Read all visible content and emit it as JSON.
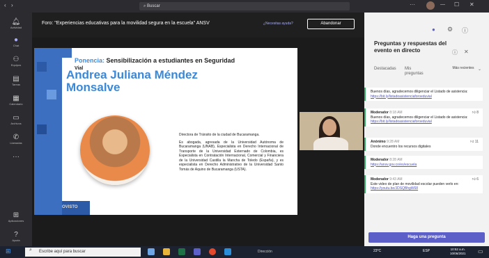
{
  "titlebar": {
    "search_placeholder": "Buscar"
  },
  "rail": [
    {
      "label": "Actividad",
      "icon": "bell-icon"
    },
    {
      "label": "Chat",
      "icon": "chat-icon"
    },
    {
      "label": "Equipos",
      "icon": "teams-icon"
    },
    {
      "label": "Tareas",
      "icon": "assignments-icon"
    },
    {
      "label": "Calendario",
      "icon": "calendar-icon"
    },
    {
      "label": "Archivos",
      "icon": "files-icon"
    },
    {
      "label": "Llamadas",
      "icon": "phone-icon"
    },
    {
      "label": "Aplicaciones",
      "icon": "apps-icon"
    },
    {
      "label": "Ayuda",
      "icon": "help-icon"
    }
  ],
  "meeting": {
    "title": "Foro: \"Experiencias educativas para la movilidad segura en la escuela\" ANSV",
    "help_link": "¿Necesitas ayuda?",
    "leave_button": "Abandonar"
  },
  "slide": {
    "ponencia_label": "Ponencia:",
    "ponencia_title": "Sensibilización a estudiantes en Seguridad",
    "ponencia_title_2": "Vial",
    "speaker_name": "Andrea Juliana Méndez Monsalve",
    "bio_role": "Directora de Tránsito de la ciudad de Bucaramanga.",
    "bio_text": "Es abogada, agresada de la Universidad Autónoma de Bucaramanga (UNAB), Especialista en Derecho Internacional de Transporte de la Universidad Externado de Colombia, es Especialista en Contratación Internacional, Comercial y Financiera de la Universidad Castilla la Mancha de Toledo (España), y es especialista en Derecho Administrativo de la Universidad Santo Tomás de Aquino de Bucaramanga (USTA).",
    "logo_text": "OVISTO"
  },
  "qna": {
    "title": "Preguntas y respuestas del evento en directo",
    "tabs": [
      "Destacadas",
      "Mis preguntas"
    ],
    "sort": "Más recientes",
    "messages": [
      {
        "author": "",
        "time": "",
        "text": "Buenos días, agradecemos diligenciar el Listado de asistencia:",
        "link": "https://bit.ly/listadoasistenciaforoeduvial",
        "likes": ""
      },
      {
        "author": "Moderador",
        "time": "8:18 AM",
        "text": "Buenos días, agradecemos diligenciar el Listado de asistencia:",
        "link": "https://bit.ly/listadoasistenciaforoeduvial",
        "likes": "8"
      },
      {
        "author": "Anónimo",
        "time": "9:28 AM",
        "text": "Donde encuentro los recursos digitales",
        "link": "",
        "likes": "11"
      },
      {
        "author": "Moderador",
        "time": "8:28 AM",
        "text": "",
        "link": "https://ansv.gov.co/es/escuela",
        "likes": ""
      },
      {
        "author": "Moderador",
        "time": "9:43 AM",
        "text": "Este video de plan de movilidad escolar pueden verlo en:",
        "link": "https://youtu.be/JDSQBhgW68",
        "likes": "6"
      }
    ],
    "ask_button": "Haga una pregunta"
  },
  "taskbar": {
    "search_placeholder": "Escribe aquí para buscar",
    "direccion": "Dirección",
    "temperature": "23°C",
    "language": "ESP",
    "time": "10:52 a.m.",
    "date": "10/06/2021"
  },
  "colors": {
    "accent": "#5b5fc7",
    "slide_blue": "#3c88d6",
    "moderator_green": "#3bb36b"
  }
}
